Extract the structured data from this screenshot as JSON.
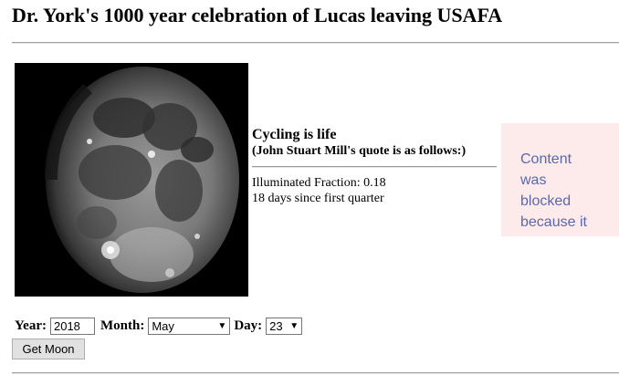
{
  "page": {
    "title": "Dr. York's 1000 year celebration of Lucas leaving USAFA"
  },
  "moon": {
    "image_alt": "moon-phase-image"
  },
  "info": {
    "quote_heading": "Cycling is life",
    "quote_subheading": "(John Stuart Mill's quote is as follows:)",
    "illuminated_fraction": "Illuminated Fraction: 0.18",
    "days_since": "18 days since first quarter"
  },
  "blocked": {
    "lines": [
      "Content",
      "was",
      "blocked",
      "because it"
    ]
  },
  "form": {
    "year_label": "Year:",
    "year_value": "2018",
    "month_label": "Month:",
    "month_value": "May",
    "day_label": "Day:",
    "day_value": "23",
    "submit_label": "Get Moon"
  },
  "colors": {
    "blocked_bg": "#fdeaea",
    "blocked_text": "#5869b0"
  }
}
